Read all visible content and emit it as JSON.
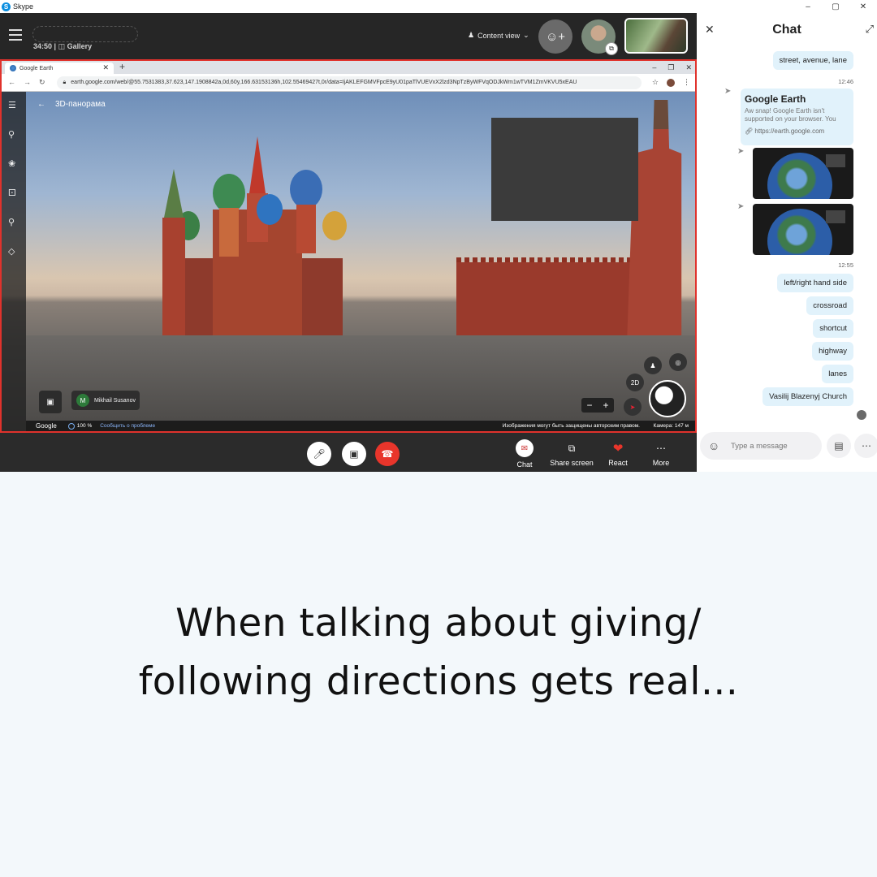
{
  "window": {
    "title": "Skype",
    "controls": [
      "–",
      "▢",
      "✕"
    ]
  },
  "call_header": {
    "time": "34:50 |",
    "view_mode": "Gallery",
    "content_view_label": "Content view"
  },
  "browser": {
    "tab_title": "Google Earth",
    "url": "earth.google.com/web/@55.7531383,37.623,147.1908842a,0d,60y,166.63153136h,102.55469427t,0r/data=IjAKLEFGMVFpcE9yU01paTlVUEVxX2lzd3NpTzByWFVqODJkWm1wTVM1ZmVKVU5xEAU"
  },
  "earth": {
    "panel_title": "3D-панорама",
    "participant_initial": "M",
    "participant_name": "Mikhail Susanov",
    "mode_2d": "2D",
    "footer": {
      "google": "Google",
      "zoom": "100 %",
      "report": "Сообщить о проблеме",
      "copyright": "Изображения могут быть защищены авторским правом.",
      "camera": "Камера: 147 м"
    }
  },
  "call_controls": {
    "chat_label": "Chat",
    "share_label": "Share screen",
    "react_label": "React",
    "more_label": "More"
  },
  "chat": {
    "title": "Chat",
    "messages_top": [
      "street, avenue, lane"
    ],
    "time1": "12:46",
    "card": {
      "title": "Google Earth",
      "desc": "Aw snap! Google Earth isn't supported on your browser. You",
      "link": "https://earth.google.com"
    },
    "time2": "12:55",
    "messages": [
      "left/right hand side",
      "crossroad",
      "shortcut",
      "highway",
      "lanes",
      "Vasilij Blazenyj Church"
    ],
    "placeholder": "Type a message"
  },
  "caption": {
    "line1": "When talking about giving/",
    "line2": "following directions gets real..."
  }
}
